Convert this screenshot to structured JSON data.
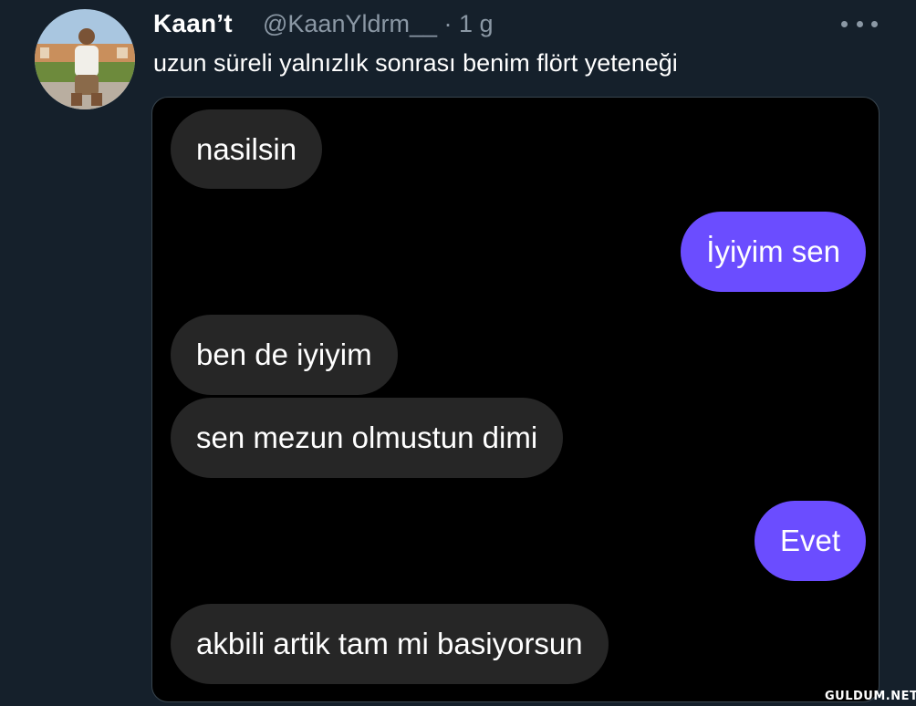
{
  "tweet": {
    "author_name": "Kaan’t",
    "handle_time": "@KaanYldrm__ · 1 g",
    "text": "uzun süreli yalnızlık sonrası benim flört yeteneği"
  },
  "chat": {
    "messages": [
      {
        "from": "them",
        "text": "nasilsin"
      },
      {
        "from": "me",
        "text": "İyiyim sen"
      },
      {
        "from": "them",
        "text": "ben de iyiyim"
      },
      {
        "from": "them",
        "text": "sen mezun olmustun dimi"
      },
      {
        "from": "me",
        "text": "Evet"
      },
      {
        "from": "them",
        "text": "akbili artik tam mi basiyorsun"
      }
    ],
    "colors": {
      "incoming": "#262626",
      "outgoing": "#6b4dff"
    }
  },
  "watermark": "GULDUM.NET",
  "icons": {
    "more": "more-horizontal-icon",
    "avatar": "profile-photo"
  }
}
